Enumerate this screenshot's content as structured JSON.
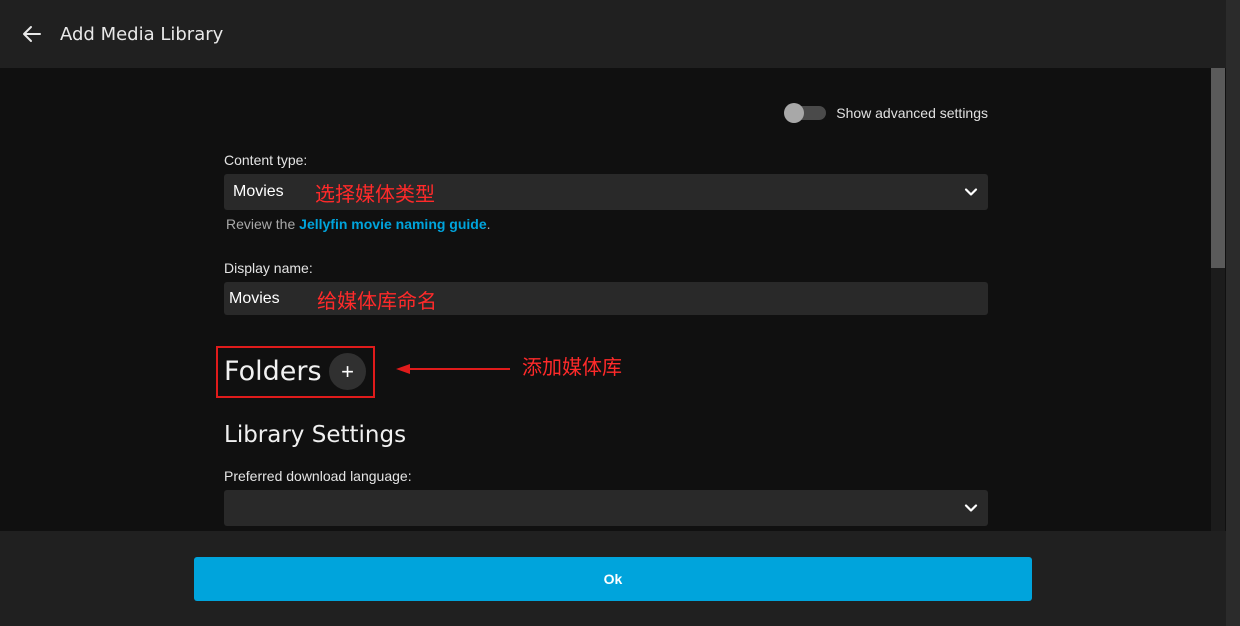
{
  "header": {
    "back_icon": "arrow-left-icon",
    "title": "Add Media Library"
  },
  "advanced": {
    "label": "Show advanced settings",
    "enabled": false
  },
  "content_type": {
    "label": "Content type:",
    "value": "Movies",
    "annotation": "选择媒体类型",
    "help_prefix": "Review the ",
    "help_link": "Jellyfin movie naming guide",
    "help_suffix": "."
  },
  "display_name": {
    "label": "Display name:",
    "value": "Movies",
    "annotation": "给媒体库命名"
  },
  "folders": {
    "title": "Folders",
    "add_symbol": "+",
    "annotation": "添加媒体库"
  },
  "library_settings": {
    "title": "Library Settings",
    "download_language_label": "Preferred download language:",
    "download_language_value": ""
  },
  "footer": {
    "ok_label": "Ok"
  },
  "colors": {
    "accent": "#00a4dc",
    "annotation": "#ff2a2a",
    "background": "#101010",
    "header": "#202020"
  }
}
